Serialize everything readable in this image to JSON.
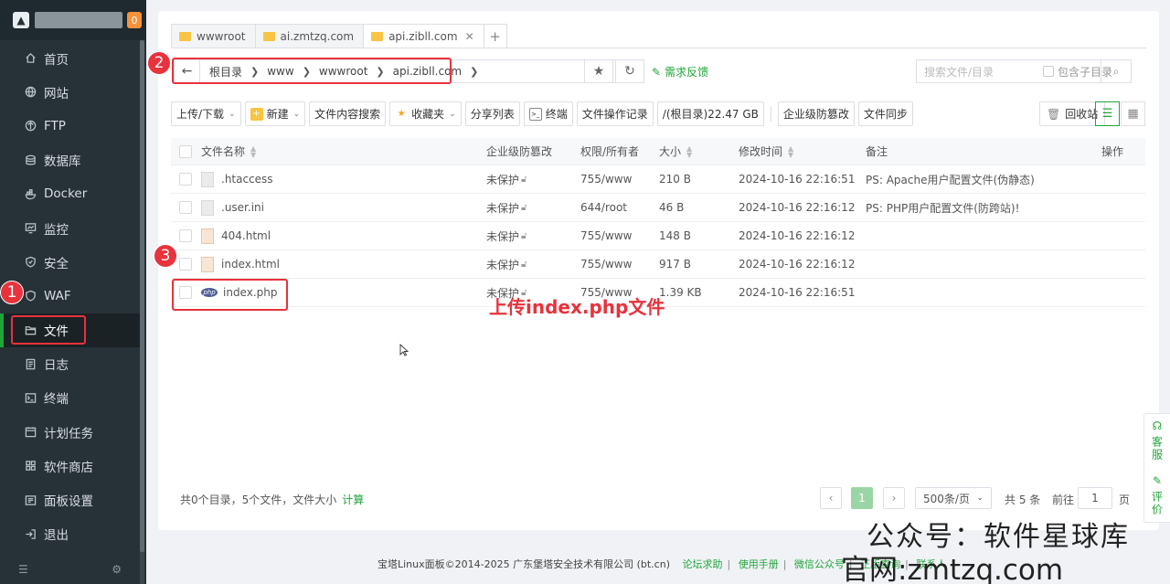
{
  "sidebar": {
    "badge": "0",
    "items": [
      {
        "label": "首页",
        "icon": "home-icon"
      },
      {
        "label": "网站",
        "icon": "globe-icon"
      },
      {
        "label": "FTP",
        "icon": "ftp-icon"
      },
      {
        "label": "数据库",
        "icon": "database-icon"
      },
      {
        "label": "Docker",
        "icon": "docker-icon"
      },
      {
        "label": "监控",
        "icon": "monitor-icon"
      },
      {
        "label": "安全",
        "icon": "shield-icon"
      },
      {
        "label": "WAF",
        "icon": "waf-shield-icon"
      },
      {
        "label": "文件",
        "icon": "folder-icon"
      },
      {
        "label": "日志",
        "icon": "log-icon"
      },
      {
        "label": "终端",
        "icon": "terminal-icon"
      },
      {
        "label": "计划任务",
        "icon": "clock-icon"
      },
      {
        "label": "软件商店",
        "icon": "store-icon"
      },
      {
        "label": "面板设置",
        "icon": "settings-icon"
      },
      {
        "label": "退出",
        "icon": "logout-icon"
      }
    ],
    "active_index": 8
  },
  "annotations": {
    "n1": "1",
    "n2": "2",
    "n3": "3",
    "note": "上传index.php文件"
  },
  "tabs": [
    {
      "label": "wwwroot"
    },
    {
      "label": "ai.zmtzq.com"
    },
    {
      "label": "api.zibll.com",
      "active": true
    }
  ],
  "path": {
    "segments": [
      "根目录",
      "www",
      "wwwroot",
      "api.zibll.com"
    ]
  },
  "feedback": "需求反馈",
  "search": {
    "placeholder": "搜索文件/目录",
    "subdir_label": "包含子目录"
  },
  "toolbar": {
    "upload": "上传/下载",
    "new": "新建",
    "content_search": "文件内容搜索",
    "favorites": "收藏夹",
    "share_list": "分享列表",
    "terminal": "终端",
    "op_log": "文件操作记录",
    "disk": "/(根目录)22.47 GB",
    "tamper": "企业级防篡改",
    "sync": "文件同步",
    "recycle": "回收站"
  },
  "table": {
    "headers": [
      "文件名称",
      "企业级防篡改",
      "权限/所有者",
      "大小",
      "修改时间",
      "备注",
      "操作"
    ],
    "rows": [
      {
        "name": ".htaccess",
        "type": "gen",
        "protect": "未保护",
        "perm": "755/www",
        "size": "210 B",
        "mtime": "2024-10-16 22:16:51",
        "note": "PS: Apache用户配置文件(伪静态)"
      },
      {
        "name": ".user.ini",
        "type": "gen",
        "protect": "未保护",
        "perm": "644/root",
        "size": "46 B",
        "mtime": "2024-10-16 22:16:12",
        "note": "PS: PHP用户配置文件(防跨站)!"
      },
      {
        "name": "404.html",
        "type": "html",
        "protect": "未保护",
        "perm": "755/www",
        "size": "148 B",
        "mtime": "2024-10-16 22:16:12",
        "note": ""
      },
      {
        "name": "index.html",
        "type": "html",
        "protect": "未保护",
        "perm": "755/www",
        "size": "917 B",
        "mtime": "2024-10-16 22:16:12",
        "note": ""
      },
      {
        "name": "index.php",
        "type": "php",
        "protect": "未保护",
        "perm": "755/www",
        "size": "1.39 KB",
        "mtime": "2024-10-16 22:16:51",
        "note": ""
      }
    ]
  },
  "summary": {
    "text": "共0个目录，5个文件，文件大小",
    "calc": "计算"
  },
  "pager": {
    "current": "1",
    "per_page": "500条/页",
    "total": "共 5 条",
    "goto_label": "前往",
    "goto_value": "1",
    "page_suffix": "页"
  },
  "footer": {
    "copyright": "宝塔Linux面板©2014-2025 广东堡塔安全技术有限公司 (bt.cn)",
    "links": [
      "论坛求助",
      "使用手册",
      "微信公众号",
      "正版查询",
      "联系人"
    ]
  },
  "sidekit": {
    "service": "客服",
    "rate": "评价"
  },
  "watermark": {
    "line1": "公众号：软件星球库",
    "line2": "官网:zmtzq.com"
  },
  "colors": {
    "accent": "#20a53a",
    "annotation": "#e8323c",
    "sidebar": "#263238"
  }
}
